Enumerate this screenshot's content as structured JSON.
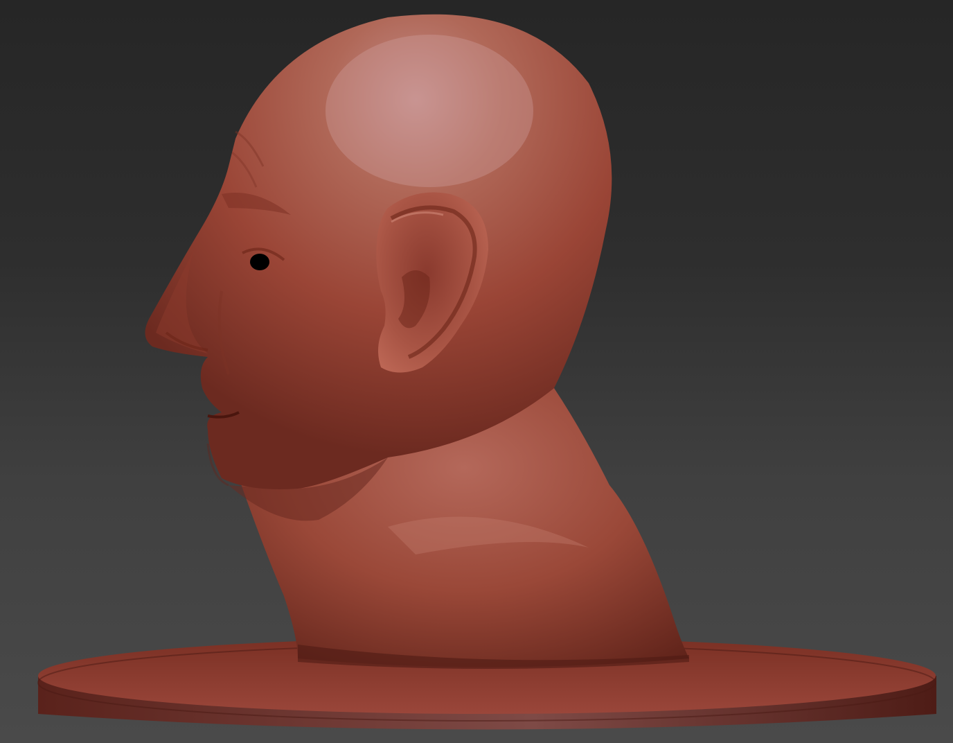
{
  "scene": {
    "subject": "sculpted-bust-profile",
    "colors": {
      "background_top": "#262626",
      "background_bottom": "#4a4a4a",
      "clay_base": "#a04a3e",
      "clay_dark": "#5a1e16",
      "clay_highlight": "#c99a96",
      "pedestal_top": "#8c3b2f",
      "pedestal_side": "#6a2a22"
    }
  }
}
